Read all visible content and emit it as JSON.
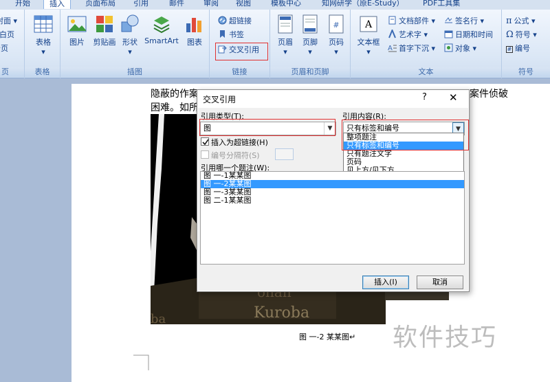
{
  "tabs": [
    "开始",
    "插入",
    "页面布局",
    "引用",
    "邮件",
    "审阅",
    "视图",
    "模板中心",
    "知网研学（原E-Study）",
    "PDF工具集"
  ],
  "active_tab": "插入",
  "ribbon": {
    "pages_group": {
      "label": "页",
      "items": [
        "封面",
        "空白页",
        "分页"
      ]
    },
    "table_group": {
      "label": "表格",
      "button": "表格"
    },
    "illustrations_group": {
      "label": "插图",
      "buttons": [
        "图片",
        "剪贴画",
        "形状",
        "SmartArt",
        "图表"
      ]
    },
    "links_group": {
      "label": "链接",
      "hyperlink": "超链接",
      "bookmark": "书签",
      "crossref": "交叉引用"
    },
    "header_footer_group": {
      "label": "页眉和页脚",
      "buttons": [
        "页眉",
        "页脚",
        "页码"
      ]
    },
    "text_group": {
      "label": "文本",
      "textbox": "文本框",
      "items": [
        "文档部件",
        "艺术字",
        "首字下沉",
        "签名行",
        "日期和时间",
        "对象"
      ]
    },
    "symbols_group": {
      "label": "符号",
      "items": [
        "公式",
        "符号",
        "编号"
      ]
    }
  },
  "document": {
    "line1_left": "隐蔽的作案",
    "line1_right": "案件侦破",
    "line2": "困难。如所",
    "photo_text1": "onan",
    "photo_text2": "Kuroba",
    "photo_text3": "ba",
    "caption": "图 一-2 某某图↵",
    "watermark": "软件技巧"
  },
  "dialog": {
    "title": "交叉引用",
    "help": "?",
    "close": "✕",
    "ref_type_label": "引用类型(T):",
    "ref_type_value": "图",
    "ref_content_label": "引用内容(R):",
    "ref_content_value": "只有标签和编号",
    "insert_hyperlink_label": "插入为超链接(H)",
    "insert_hyperlink_checked": true,
    "separator_label": "编号分隔符(S)",
    "which_caption_label": "引用哪一个题注(W):",
    "captions": [
      "图 一-1某某图",
      "图 一-2某某图",
      "图 一-3某某图",
      "图 二-1某某图"
    ],
    "selected_caption_index": 1,
    "content_options": [
      "整项题注",
      "只有标签和编号",
      "只有题注文字",
      "页码",
      "见上方/见下方"
    ],
    "selected_content_index": 1,
    "insert_button": "插入(I)",
    "cancel_button": "取消"
  }
}
